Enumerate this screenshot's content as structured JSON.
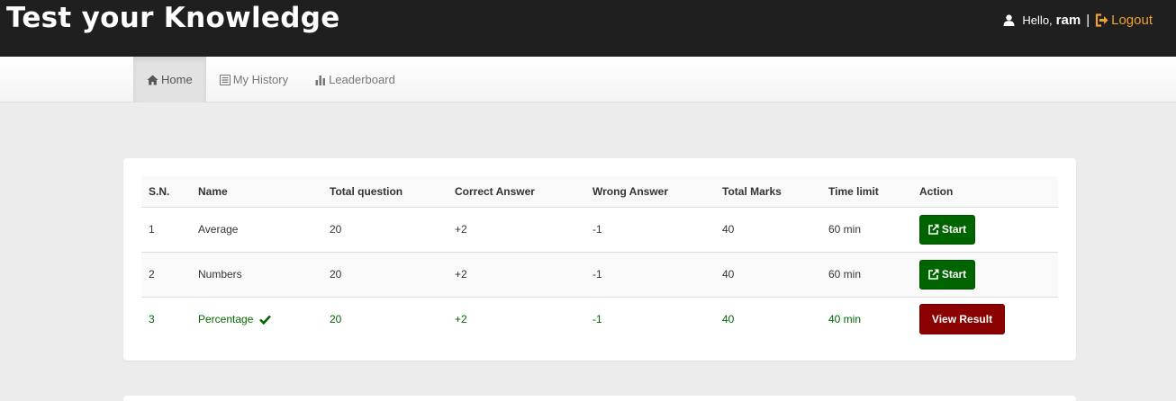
{
  "header": {
    "brand": "Test your Knowledge",
    "greeting": "Hello,",
    "username": "ram",
    "separator": "|",
    "logout_label": "Logout"
  },
  "nav": {
    "items": [
      {
        "label": "Home",
        "icon": "home-icon",
        "active": true
      },
      {
        "label": "My History",
        "icon": "list-icon",
        "active": false
      },
      {
        "label": "Leaderboard",
        "icon": "bar-chart-icon",
        "active": false
      }
    ]
  },
  "table": {
    "headers": [
      "S.N.",
      "Name",
      "Total question",
      "Correct Answer",
      "Wrong Answer",
      "Total Marks",
      "Time limit",
      "Action"
    ],
    "rows": [
      {
        "sn": "1",
        "name": "Average",
        "total_question": "20",
        "correct": "+2",
        "wrong": "-1",
        "marks": "40",
        "time": "60 min",
        "action": "Start",
        "completed": false
      },
      {
        "sn": "2",
        "name": "Numbers",
        "total_question": "20",
        "correct": "+2",
        "wrong": "-1",
        "marks": "40",
        "time": "60 min",
        "action": "Start",
        "completed": false
      },
      {
        "sn": "3",
        "name": "Percentage",
        "total_question": "20",
        "correct": "+2",
        "wrong": "-1",
        "marks": "40",
        "time": "40 min",
        "action": "View Result",
        "completed": true
      }
    ]
  },
  "colors": {
    "topbar": "#1f1f1f",
    "logout": "#f0a030",
    "start_button": "#006400",
    "result_button": "#8b0000",
    "completed_text": "#006600"
  }
}
